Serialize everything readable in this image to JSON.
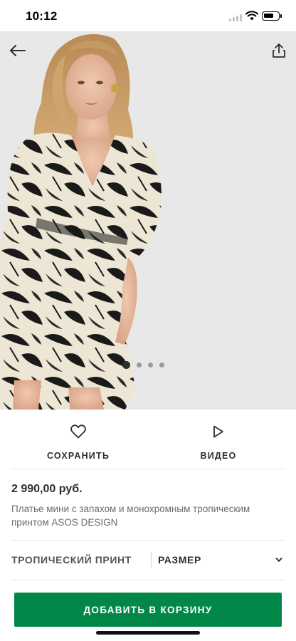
{
  "status_bar": {
    "time": "10:12"
  },
  "product_image": {
    "description_icon": "product-photo",
    "gallery": {
      "count": 4,
      "active_index": 0
    }
  },
  "nav": {
    "back_icon": "arrow-left-icon",
    "share_icon": "share-icon"
  },
  "actions": {
    "save_label": "СОХРАНИТЬ",
    "save_icon": "heart-icon",
    "video_label": "ВИДЕО",
    "video_icon": "play-icon"
  },
  "product": {
    "price": "2 990,00 руб.",
    "description": "Платье мини с запахом и монохромным тропическим принтом ASOS DESIGN"
  },
  "options": {
    "color_label": "ТРОПИЧЕСКИЙ ПРИНТ",
    "size_placeholder": "РАЗМЕР"
  },
  "cart": {
    "button_label": "ДОБАВИТЬ В КОРЗИНУ"
  },
  "colors": {
    "accent_green": "#018849",
    "text_dark": "#2d2d2d",
    "text_muted": "#6c6c6c",
    "image_background": "#e9e8e9"
  }
}
